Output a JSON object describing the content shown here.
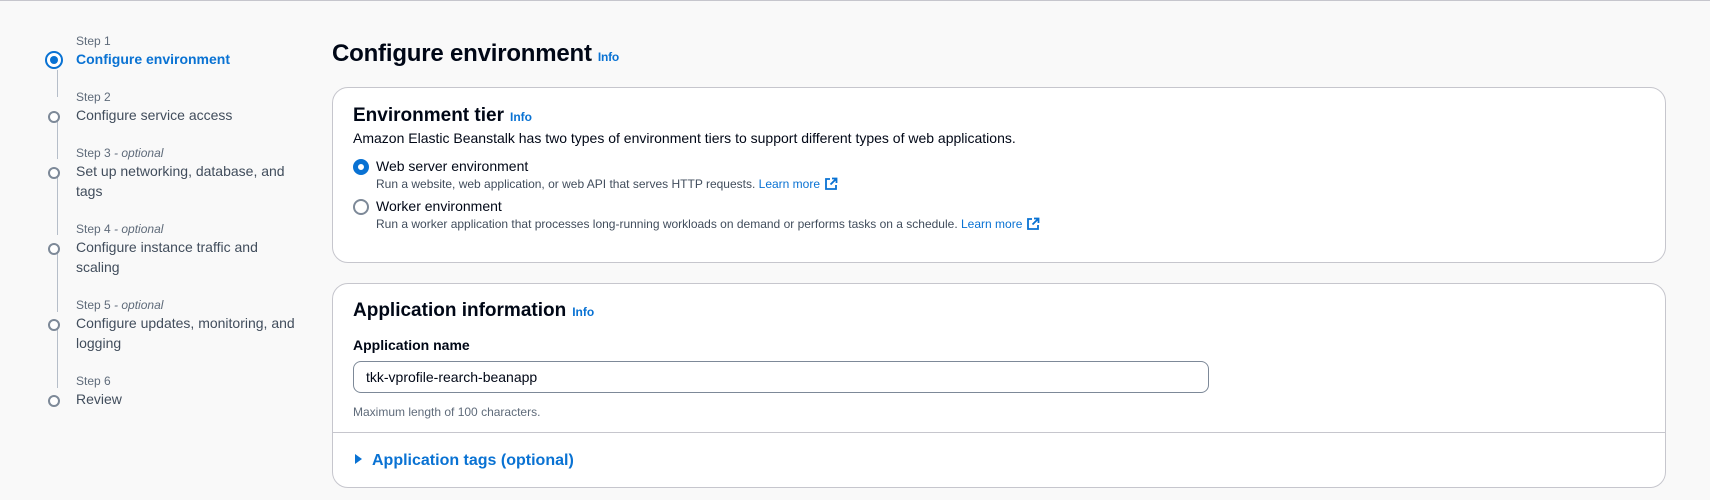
{
  "wizard": {
    "steps": [
      {
        "num": "Step 1",
        "optional": "",
        "label_lines": [
          "Configure environment"
        ],
        "active": true
      },
      {
        "num": "Step 2",
        "optional": "",
        "label_lines": [
          "Configure service access"
        ],
        "active": false
      },
      {
        "num": "Step 3",
        "optional": " - optional",
        "label_lines": [
          "Set up networking, database, and",
          "tags"
        ],
        "active": false
      },
      {
        "num": "Step 4",
        "optional": " - optional",
        "label_lines": [
          "Configure instance traffic and",
          "scaling"
        ],
        "active": false
      },
      {
        "num": "Step 5",
        "optional": " - optional",
        "label_lines": [
          "Configure updates, monitoring, and",
          "logging"
        ],
        "active": false
      },
      {
        "num": "Step 6",
        "optional": "",
        "label_lines": [
          "Review"
        ],
        "active": false
      }
    ]
  },
  "page": {
    "title": "Configure environment",
    "info": "Info"
  },
  "environment_tier": {
    "heading": "Environment tier",
    "info": "Info",
    "description": "Amazon Elastic Beanstalk has two types of environment tiers to support different types of web applications.",
    "options": [
      {
        "label": "Web server environment",
        "description": "Run a website, web application, or web API that serves HTTP requests.",
        "link": "Learn more",
        "selected": true
      },
      {
        "label": "Worker environment",
        "description": "Run a worker application that processes long-running workloads on demand or performs tasks on a schedule.",
        "link": "Learn more",
        "selected": false
      }
    ]
  },
  "application_info": {
    "heading": "Application information",
    "info": "Info",
    "name_label": "Application name",
    "name_value": "tkk-vprofile-rearch-beanapp",
    "hint": "Maximum length of 100 characters.",
    "tags_expander": "Application tags (optional)"
  },
  "colors": {
    "accent": "#0972d3",
    "text": "#000716",
    "muted": "#5f6b7a",
    "border": "#c6c6cd",
    "background": "#f9f9f9"
  }
}
